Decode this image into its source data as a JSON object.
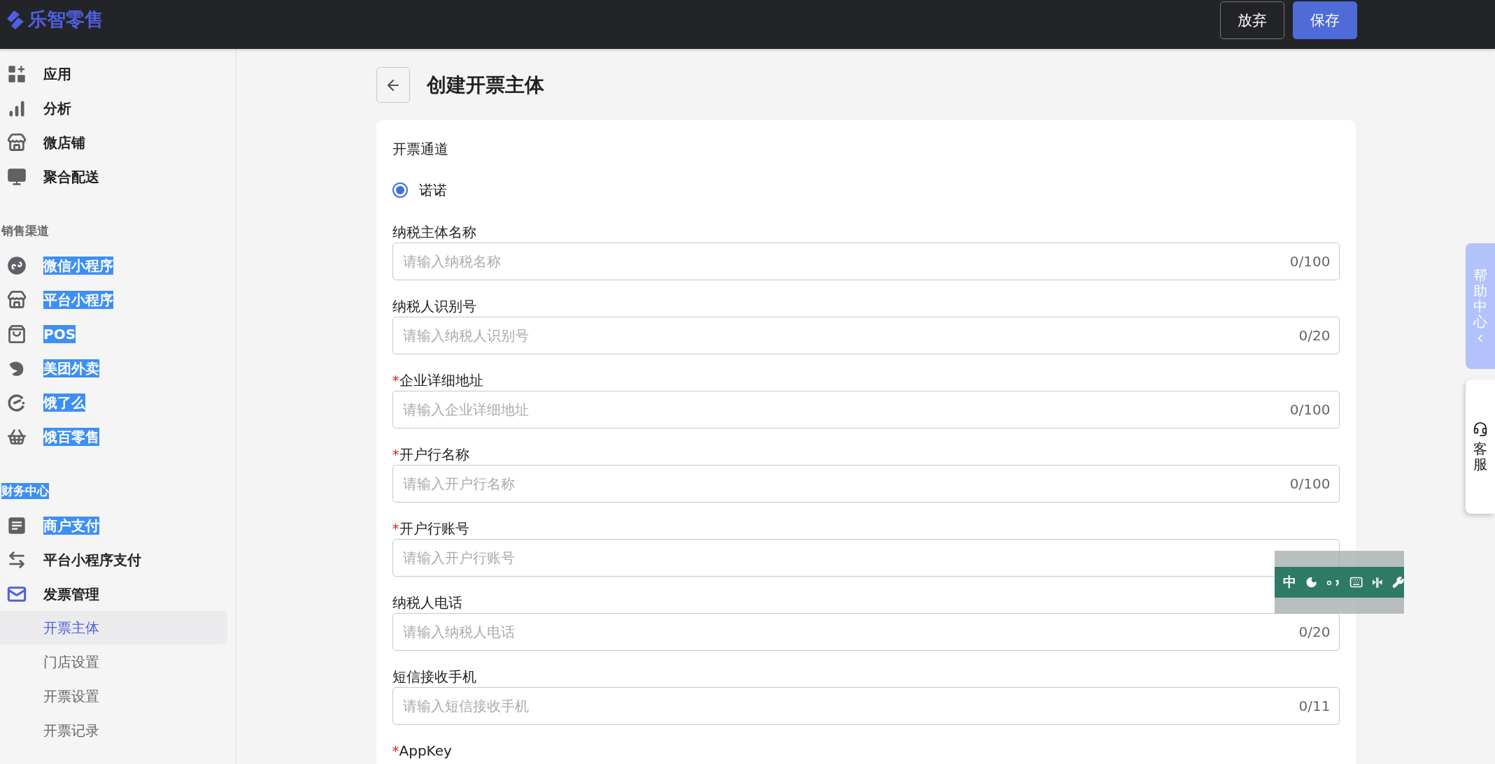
{
  "header": {
    "logo": "乐智零售",
    "buttons": [
      {
        "label": "放弃",
        "kind": "outline"
      },
      {
        "label": "保存",
        "kind": "primary"
      }
    ]
  },
  "sidebar": {
    "sections": [
      {
        "items": [
          {
            "label": "应用",
            "highlighted": false
          },
          {
            "label": "分析",
            "highlighted": false
          },
          {
            "label": "微店铺",
            "highlighted": false
          },
          {
            "label": "聚合配送",
            "highlighted": false
          }
        ]
      },
      {
        "title": "销售渠道",
        "title_highlighted": false,
        "items": [
          {
            "label": "微信小程序",
            "highlighted": true
          },
          {
            "label": "平台小程序",
            "highlighted": true
          },
          {
            "label": "POS",
            "highlighted": true
          },
          {
            "label": "美团外卖",
            "highlighted": true
          },
          {
            "label": "饿了么",
            "highlighted": true
          },
          {
            "label": "饿百零售",
            "highlighted": true
          }
        ]
      },
      {
        "title": "财务中心",
        "title_highlighted": true,
        "items": [
          {
            "label": "商户支付",
            "highlighted": true
          },
          {
            "label": "平台小程序支付",
            "highlighted": false
          },
          {
            "label": "发票管理",
            "highlighted": false,
            "expanded": true,
            "children": [
              {
                "label": "开票主体",
                "selected": true
              },
              {
                "label": "门店设置",
                "selected": false
              },
              {
                "label": "开票设置",
                "selected": false
              },
              {
                "label": "开票记录",
                "selected": false
              }
            ]
          }
        ]
      }
    ]
  },
  "page": {
    "title": "创建开票主体"
  },
  "form": {
    "channel_label": "开票通道",
    "channel_options": [
      {
        "label": "诺诺",
        "selected": true
      }
    ],
    "fields": [
      {
        "label": "纳税主体名称",
        "placeholder": "请输入纳税名称",
        "counter": "0/100"
      },
      {
        "label": "纳税人识别号",
        "placeholder": "请输入纳税人识别号",
        "counter": "0/20"
      },
      {
        "label": "企业详细地址",
        "required_mark": "*",
        "placeholder": "请输入企业详细地址",
        "counter": "0/100"
      },
      {
        "label": "开户行名称",
        "required_mark": "*",
        "placeholder": "请输入开户行名称",
        "counter": "0/100"
      },
      {
        "label": "开户行账号",
        "required_mark": "*",
        "placeholder": "请输入开户行账号"
      },
      {
        "label": "纳税人电话",
        "placeholder": "请输入纳税人电话",
        "counter": "0/20"
      },
      {
        "label": "短信接收手机",
        "placeholder": "请输入短信接收手机",
        "counter": "0/11"
      },
      {
        "label": "AppKey",
        "required_mark": "*"
      }
    ]
  },
  "help_tab": {
    "label": "帮助中心"
  },
  "service_tab": {
    "label": "客服"
  },
  "ime_toolbar": {
    "mode": "中"
  }
}
